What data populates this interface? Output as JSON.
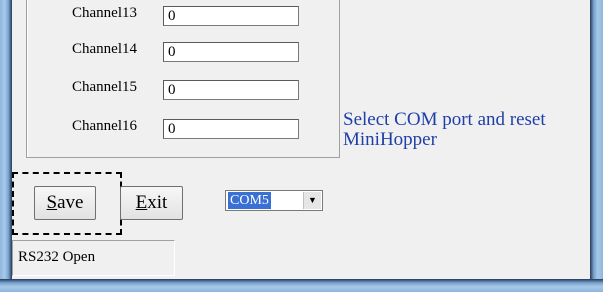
{
  "channels": [
    {
      "label": "Channel13",
      "value": "0"
    },
    {
      "label": "Channel14",
      "value": "0"
    },
    {
      "label": "Channel15",
      "value": "0"
    },
    {
      "label": "Channel16",
      "value": "0"
    }
  ],
  "hint": "Select COM port and reset MiniHopper",
  "buttons": {
    "save_underline": "S",
    "save_rest": "ave",
    "exit_underline": "E",
    "exit_rest": "xit"
  },
  "com_port": {
    "selected": "COM5",
    "dropdown_icon": "chevron-down-icon"
  },
  "status": "RS232 Open"
}
